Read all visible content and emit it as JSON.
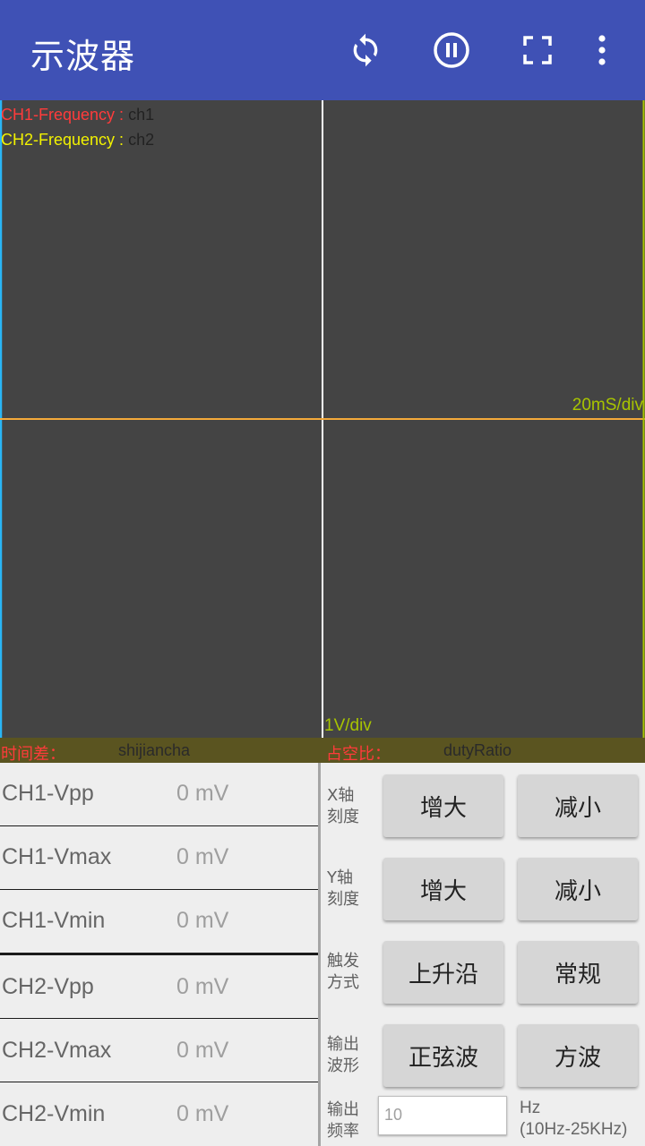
{
  "app_bar": {
    "title": "示波器",
    "icons": [
      "refresh-icon",
      "pause-icon",
      "fullscreen-icon",
      "more-vert-icon"
    ],
    "color": "#3f51b5"
  },
  "scope": {
    "ch1_frequency_label": "CH1-Frequency :",
    "ch1_frequency_value": "ch1",
    "ch2_frequency_label": "CH2-Frequency :",
    "ch2_frequency_value": "ch2",
    "x_scale": "20mS/div",
    "y_scale": "1V/div",
    "ch1_color": "#ff3b3b",
    "ch2_color": "#f2f200",
    "background": "#444444"
  },
  "info_bar": {
    "time_diff_label": "时间差：",
    "time_diff_value": "shijiancha",
    "duty_label": "占空比：",
    "duty_value": "dutyRatio"
  },
  "measurements": [
    {
      "label": "CH1-Vpp",
      "value": "0 mV"
    },
    {
      "label": "CH1-Vmax",
      "value": "0 mV"
    },
    {
      "label": "CH1-Vmin",
      "value": "0 mV"
    },
    {
      "label": "CH2-Vpp",
      "value": "0 mV"
    },
    {
      "label": "CH2-Vmax",
      "value": "0 mV"
    },
    {
      "label": "CH2-Vmin",
      "value": "0 mV"
    }
  ],
  "controls": {
    "x_axis": {
      "label_line1": "X轴",
      "label_line2": "刻度",
      "increase": "增大",
      "decrease": "减小"
    },
    "y_axis": {
      "label_line1": "Y轴",
      "label_line2": "刻度",
      "increase": "增大",
      "decrease": "减小"
    },
    "trigger": {
      "label_line1": "触发",
      "label_line2": "方式",
      "rising": "上升沿",
      "normal": "常规"
    },
    "waveform": {
      "label_line1": "输出",
      "label_line2": "波形",
      "sine": "正弦波",
      "square": "方波"
    },
    "frequency": {
      "label_line1": "输出",
      "label_line2": "频率",
      "placeholder": "10",
      "unit": "Hz",
      "range": "(10Hz-25KHz)"
    }
  }
}
